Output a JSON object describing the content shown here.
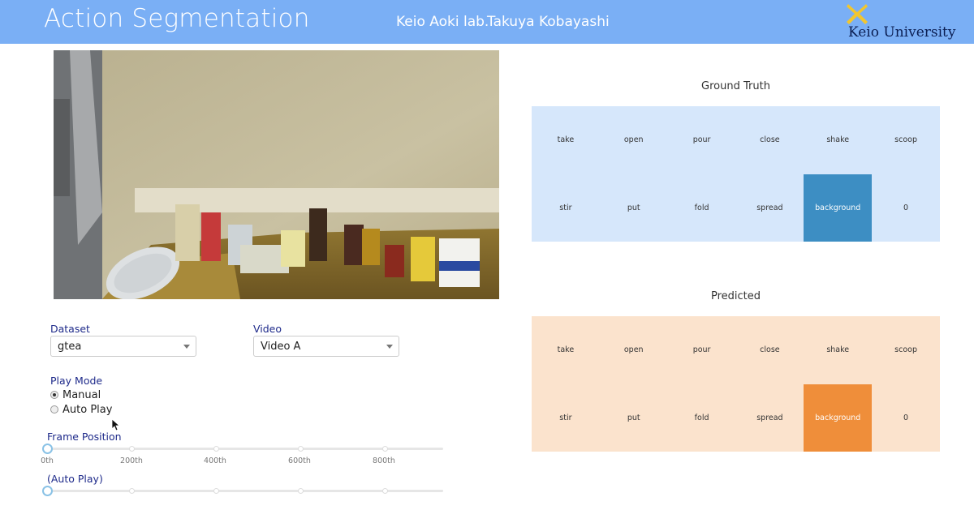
{
  "header": {
    "title": "Action Segmentation",
    "lab": "Keio Aoki lab.",
    "author": "Takuya Kobayashi",
    "logo_text": "Keio University"
  },
  "controls": {
    "dataset_label": "Dataset",
    "dataset_value": "gtea",
    "video_label": "Video",
    "video_value": "Video A",
    "play_mode_label": "Play Mode",
    "play_modes": [
      "Manual",
      "Auto Play"
    ],
    "selected_mode": "Manual",
    "frame_position_label": "Frame Position",
    "frame_ticks": [
      "0th",
      "200th",
      "400th",
      "600th",
      "800th"
    ],
    "frame_value": 0,
    "auto_play_label": "(Auto Play)"
  },
  "ground_truth": {
    "title": "Ground Truth",
    "classes": [
      "take",
      "open",
      "pour",
      "close",
      "shake",
      "scoop",
      "stir",
      "put",
      "fold",
      "spread",
      "background",
      "0"
    ],
    "active": "background",
    "bg_color": "#d6e7fb",
    "active_color": "#3d8ec3"
  },
  "predicted": {
    "title": "Predicted",
    "classes": [
      "take",
      "open",
      "pour",
      "close",
      "shake",
      "scoop",
      "stir",
      "put",
      "fold",
      "spread",
      "background",
      "0"
    ],
    "active": "background",
    "bg_color": "#fbe3cd",
    "active_color": "#ef8e3a"
  },
  "colors": {
    "header_bg": "#7aaff5",
    "label_color": "#1e2a8a",
    "logo_mark": "#f2c62e"
  }
}
